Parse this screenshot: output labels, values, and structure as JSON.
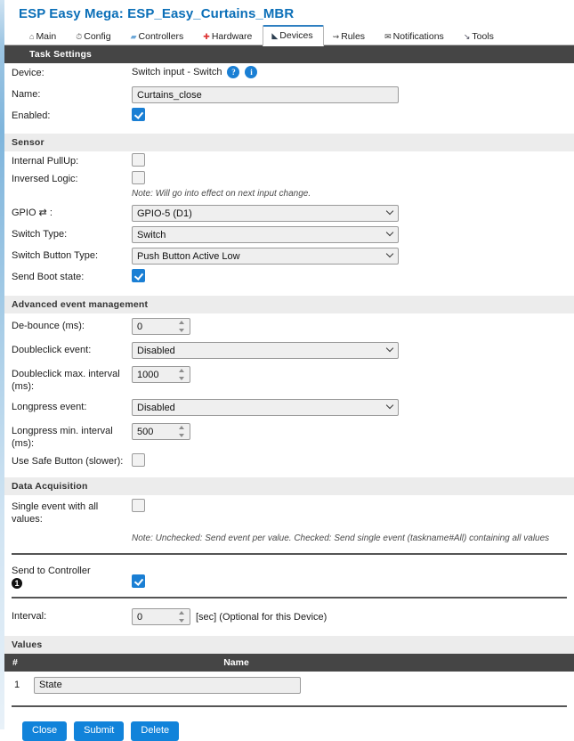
{
  "header": {
    "title": "ESP Easy Mega: ESP_Easy_Curtains_MBR",
    "tabs": [
      {
        "label": "Main",
        "icon": "home-icon",
        "glyph": "⌂",
        "active": false
      },
      {
        "label": "Config",
        "icon": "gear-icon",
        "glyph": "◔",
        "active": false
      },
      {
        "label": "Controllers",
        "icon": "chat-icon",
        "glyph": "💬",
        "active": false
      },
      {
        "label": "Hardware",
        "icon": "pin-icon",
        "glyph": "📌",
        "active": false
      },
      {
        "label": "Devices",
        "icon": "plug-icon",
        "glyph": "🔌",
        "active": true
      },
      {
        "label": "Rules",
        "icon": "flow-icon",
        "glyph": "⇝",
        "active": false
      },
      {
        "label": "Notifications",
        "icon": "envelope-icon",
        "glyph": "✉",
        "active": false
      },
      {
        "label": "Tools",
        "icon": "wrench-icon",
        "glyph": "🔧",
        "active": false
      }
    ]
  },
  "sections": {
    "task_settings": "Task Settings",
    "sensor": "Sensor",
    "advanced": "Advanced event management",
    "data_acquisition": "Data Acquisition",
    "values": "Values"
  },
  "task_settings": {
    "device_label": "Device:",
    "device_value": "Switch input - Switch",
    "help_icon": "?",
    "info_icon": "i",
    "name_label": "Name:",
    "name_value": "Curtains_close",
    "enabled_label": "Enabled:",
    "enabled_checked": true
  },
  "sensor": {
    "internal_pullup_label": "Internal PullUp:",
    "internal_pullup_checked": false,
    "inversed_logic_label": "Inversed Logic:",
    "inversed_logic_checked": false,
    "note": "Note: Will go into effect on next input change.",
    "gpio_label": "GPIO ⇄ :",
    "gpio_value": "GPIO-5 (D1)",
    "switch_type_label": "Switch Type:",
    "switch_type_value": "Switch",
    "switch_button_type_label": "Switch Button Type:",
    "switch_button_type_value": "Push Button Active Low",
    "send_boot_state_label": "Send Boot state:",
    "send_boot_state_checked": true
  },
  "advanced": {
    "debounce_label": "De-bounce (ms):",
    "debounce_value": "0",
    "doubleclick_event_label": "Doubleclick event:",
    "doubleclick_event_value": "Disabled",
    "doubleclick_interval_label": "Doubleclick max. interval (ms):",
    "doubleclick_interval_value": "1000",
    "longpress_event_label": "Longpress event:",
    "longpress_event_value": "Disabled",
    "longpress_interval_label": "Longpress min. interval (ms):",
    "longpress_interval_value": "500",
    "safe_button_label": "Use Safe Button (slower):",
    "safe_button_checked": false
  },
  "data_acquisition": {
    "single_event_label": "Single event with all values:",
    "single_event_checked": false,
    "note": "Note: Unchecked: Send event per value. Checked: Send single event (taskname#All) containing all values",
    "send_to_controller_label": "Send to Controller",
    "send_to_controller_index": "1",
    "send_to_controller_checked": true,
    "interval_label": "Interval:",
    "interval_value": "0",
    "interval_suffix": "[sec] (Optional for this Device)"
  },
  "values_table": {
    "columns": [
      "#",
      "Name"
    ],
    "rows": [
      {
        "num": "1",
        "name": "State"
      }
    ]
  },
  "buttons": [
    {
      "label": "Close",
      "name": "close-button"
    },
    {
      "label": "Submit",
      "name": "submit-button"
    },
    {
      "label": "Delete",
      "name": "delete-button"
    }
  ],
  "colors": {
    "accent": "#1183da",
    "title": "#0b6fb8",
    "section_dark": "#454545",
    "section_light": "#ececec",
    "tab_active_top": "#2e7fc1"
  }
}
